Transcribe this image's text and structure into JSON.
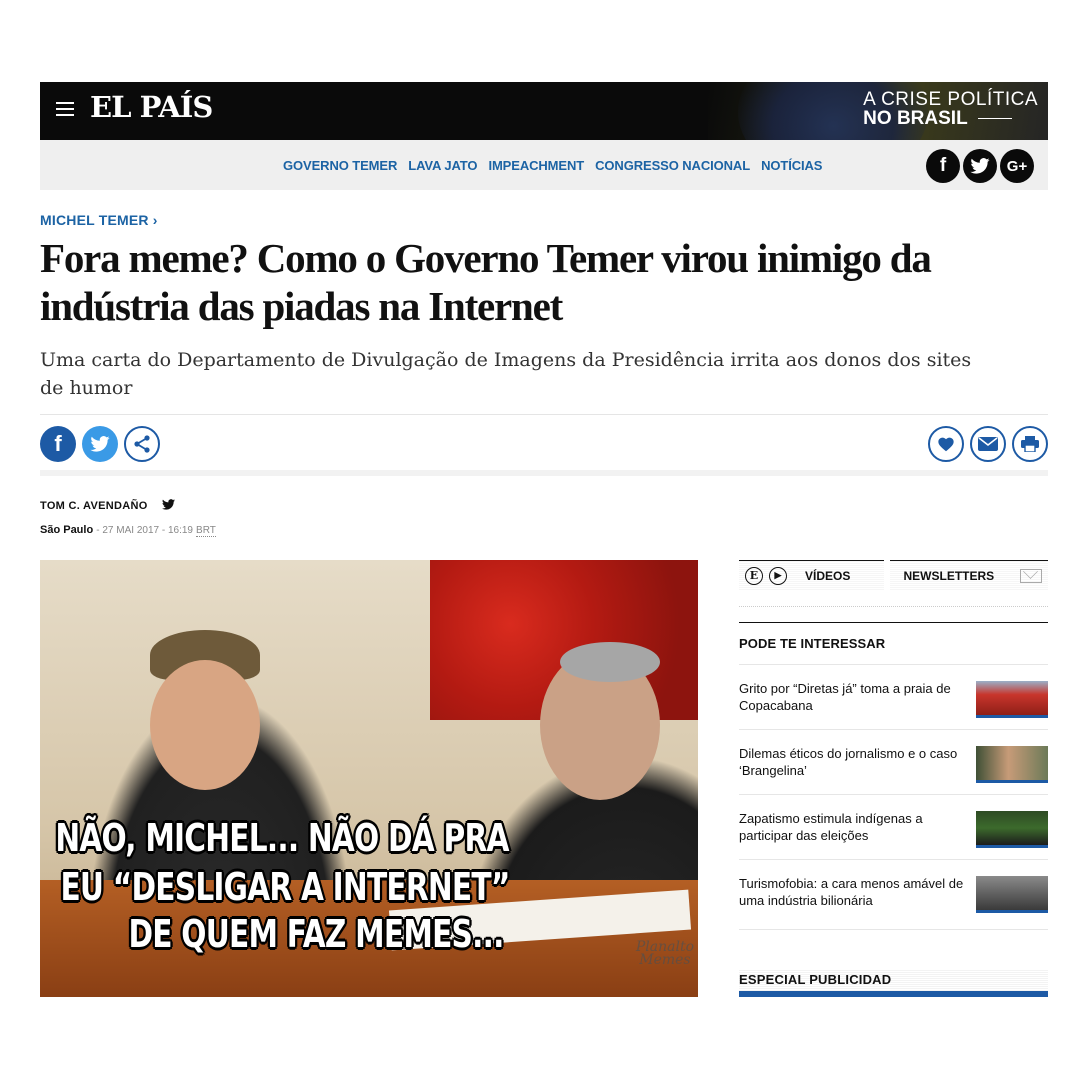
{
  "topbar": {
    "logo": "EL PAÍS",
    "crisis_line1": "A CRISE POLÍTICA",
    "crisis_line2": "NO BRASIL"
  },
  "nav": {
    "links": [
      "GOVERNO TEMER",
      "LAVA JATO",
      "IMPEACHMENT",
      "CONGRESSO NACIONAL",
      "NOTÍCIAS"
    ],
    "social": [
      {
        "icon": "facebook-icon",
        "glyph": "f"
      },
      {
        "icon": "twitter-icon",
        "glyph": "t"
      },
      {
        "icon": "google-plus-icon",
        "glyph": "G+"
      }
    ]
  },
  "article": {
    "section": "MICHEL TEMER ›",
    "headline": "Fora meme? Como o Governo Temer virou inimigo da indústria das piadas na Internet",
    "subhead": "Uma carta do Departamento de Divulgação de Imagens da Presidência irrita aos donos dos sites de humor",
    "author": "TOM C. AVENDAÑO",
    "city": "São Paulo",
    "date": "- 27 MAI 2017 - 16:19",
    "timezone": "BRT",
    "image": {
      "meme_line1": "NÃO, MICHEL... NÃO DÁ PRA",
      "meme_line2": "EU “DESLIGAR A INTERNET”",
      "meme_line3": "DE QUEM FAZ MEMES...",
      "watermark_line1": "Planalto",
      "watermark_line2": "Memes"
    }
  },
  "sidebar": {
    "tab_videos": "VÍDEOS",
    "tab_newsletters": "NEWSLETTERS",
    "title": "PODE TE INTERESSAR",
    "items": [
      {
        "label": "Grito por “Diretas já” toma a praia de Copacabana",
        "thumb": "#c8352c"
      },
      {
        "label": "Dilemas éticos do jornalismo e o caso ‘Brangelina’",
        "thumb": "#5b6e4a"
      },
      {
        "label": "Zapatismo estimula indígenas a participar das eleições",
        "thumb": "#2e4b24"
      },
      {
        "label": "Turismofobia: a cara menos amável de uma indústria bilionária",
        "thumb": "#6b6b6b"
      }
    ],
    "special": "ESPECIAL PUBLICIDAD"
  },
  "colors": {
    "accent_blue": "#1c63a4",
    "twitter_blue": "#3a9ae6",
    "facebook_blue": "#1d5aa5",
    "topbar_black": "#0a0a0a"
  }
}
